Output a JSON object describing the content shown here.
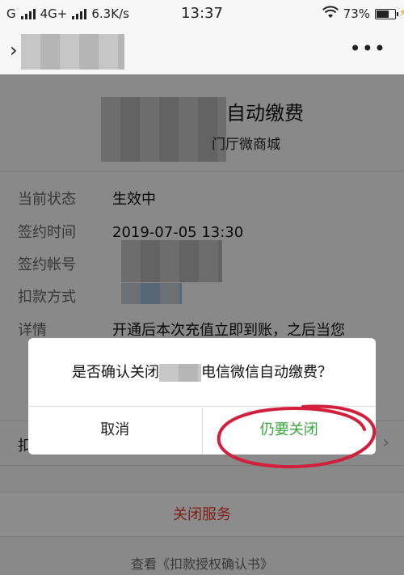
{
  "status_bar": {
    "carrier_1": "G",
    "carrier_2": "4G+",
    "speed": "6.3K/s",
    "time": "13:37",
    "battery": "73%",
    "battery_level": 0.73
  },
  "nav": {
    "close_icon": "close-chevron-icon",
    "more_icon": "more-dots-icon"
  },
  "header": {
    "title": "自动缴费",
    "subtitle": "门厅微商城"
  },
  "details": [
    {
      "label": "当前状态",
      "value": "生效中"
    },
    {
      "label": "签约时间",
      "value": "2019-07-05 13:30"
    },
    {
      "label": "签约帐号",
      "value": ""
    },
    {
      "label": "扣款方式",
      "value": ""
    },
    {
      "label": "详情",
      "value": "开通后本次充值立即到账，之后当您"
    }
  ],
  "row_item": {
    "label": "扣"
  },
  "close_service": "关闭服务",
  "agreement_link": "查看《扣款授权确认书》",
  "dialog": {
    "message_prefix": "是否确认关闭",
    "message_suffix": "电信微信自动缴费？",
    "cancel": "取消",
    "confirm": "仍要关闭"
  },
  "colors": {
    "confirm_green": "#3aa53a",
    "danger_red": "#e23a2a",
    "annotation_red": "#d21f3c"
  }
}
